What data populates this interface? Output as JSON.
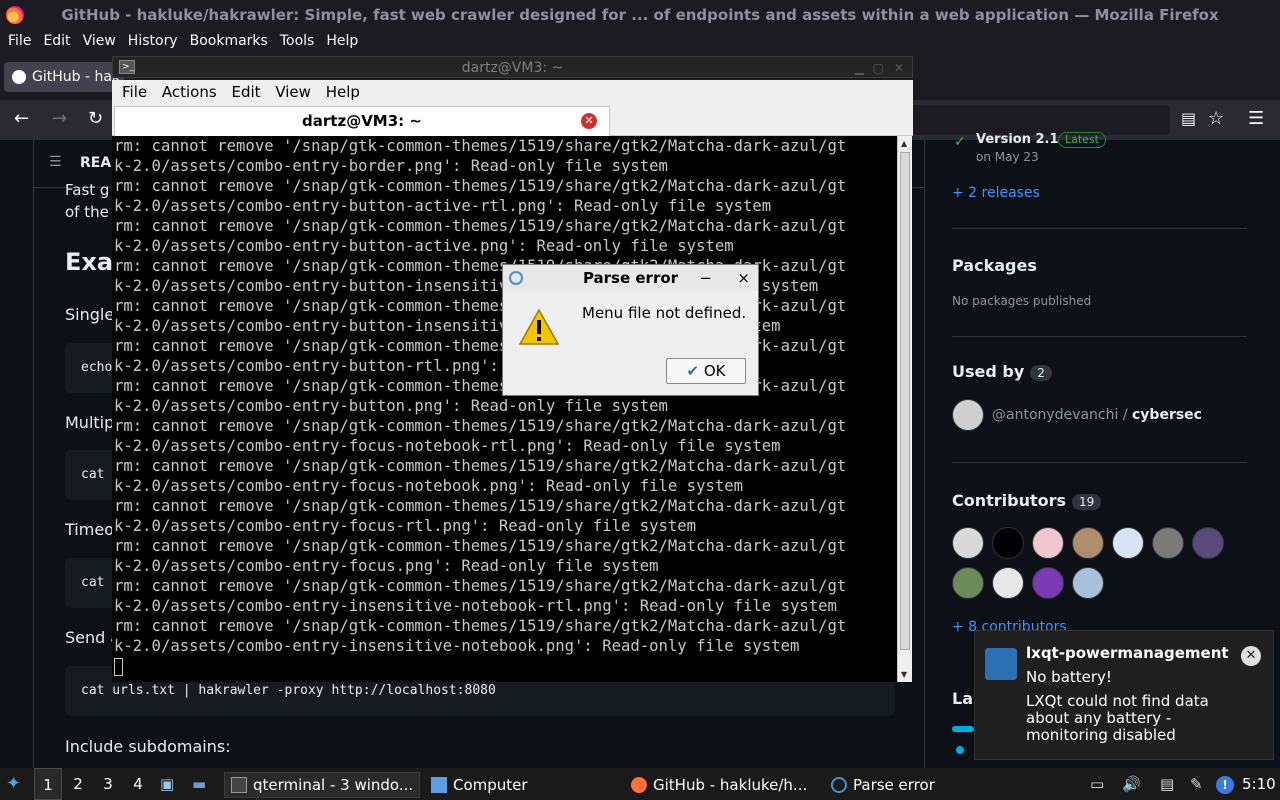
{
  "firefox": {
    "title": "GitHub - hakluke/hakrawler: Simple, fast web crawler designed for ...  of endpoints and assets within a web application — Mozilla Firefox",
    "menu": [
      "File",
      "Edit",
      "View",
      "History",
      "Bookmarks",
      "Tools",
      "Help"
    ],
    "tab_label": "GitHub - hak",
    "icons": [
      "back-arrow-icon",
      "forward-arrow-icon",
      "reload-icon",
      "reader-view-icon",
      "star-icon",
      "hamburger-menu-icon"
    ]
  },
  "github": {
    "readme_label": "REA",
    "fast_fragment": "Fast g",
    "of_the_fragment": "of the",
    "examples_heading": "Exa",
    "single_fragment": "Single",
    "code1": "echo",
    "multiple_fragment": "Multipl",
    "code2": "cat",
    "timeout_fragment": "Timeo",
    "code3": "cat",
    "send_fragment": "Send a",
    "proxy_code": "cat urls.txt | hakrawler -proxy http://localhost:8080",
    "include_subdomains": "Include subdomains:",
    "release_version": "Version 2.1",
    "release_badge": "Latest",
    "release_date": "on May 23",
    "releases_link": "+ 2 releases",
    "packages_heading": "Packages",
    "packages_text": "No packages published",
    "used_by_heading": "Used by",
    "used_by_count": "2",
    "used_by_user": "@antonydevanchi",
    "used_by_sep": "/",
    "used_by_repo": "cybersec",
    "contributors_heading": "Contributors",
    "contributors_count": "19",
    "more_contributors": "+ 8 contributors",
    "languages_fragment": "Lar"
  },
  "terminal": {
    "window_title": "dartz@VM3: ~",
    "menu": [
      "File",
      "Actions",
      "Edit",
      "View",
      "Help"
    ],
    "tab_title": "dartz@VM3: ~",
    "lines": [
      "rm: cannot remove '/snap/gtk-common-themes/1519/share/gtk2/Matcha-dark-azul/gt",
      "k-2.0/assets/combo-entry-border.png': Read-only file system",
      "rm: cannot remove '/snap/gtk-common-themes/1519/share/gtk2/Matcha-dark-azul/gt",
      "k-2.0/assets/combo-entry-button-active-rtl.png': Read-only file system",
      "rm: cannot remove '/snap/gtk-common-themes/1519/share/gtk2/Matcha-dark-azul/gt",
      "k-2.0/assets/combo-entry-button-active.png': Read-only file system",
      "rm: cannot remove '/snap/gtk-common-themes/1519/share/gtk2/Matcha-dark-azul/gt",
      "k-2.0/assets/combo-entry-button-insensitive-rtl.png': Read-only file system",
      "rm: cannot remove '/snap/gtk-common-themes/1519/share/gtk2/Matcha-dark-azul/gt",
      "k-2.0/assets/combo-entry-button-insensitive.png': Read-only file system",
      "rm: cannot remove '/snap/gtk-common-themes/1519/share/gtk2/Matcha-dark-azul/gt",
      "k-2.0/assets/combo-entry-button-rtl.png': Read-only file system",
      "rm: cannot remove '/snap/gtk-common-themes/1519/share/gtk2/Matcha-dark-azul/gt",
      "k-2.0/assets/combo-entry-button.png': Read-only file system",
      "rm: cannot remove '/snap/gtk-common-themes/1519/share/gtk2/Matcha-dark-azul/gt",
      "k-2.0/assets/combo-entry-focus-notebook-rtl.png': Read-only file system",
      "rm: cannot remove '/snap/gtk-common-themes/1519/share/gtk2/Matcha-dark-azul/gt",
      "k-2.0/assets/combo-entry-focus-notebook.png': Read-only file system",
      "rm: cannot remove '/snap/gtk-common-themes/1519/share/gtk2/Matcha-dark-azul/gt",
      "k-2.0/assets/combo-entry-focus-rtl.png': Read-only file system",
      "rm: cannot remove '/snap/gtk-common-themes/1519/share/gtk2/Matcha-dark-azul/gt",
      "k-2.0/assets/combo-entry-focus.png': Read-only file system",
      "rm: cannot remove '/snap/gtk-common-themes/1519/share/gtk2/Matcha-dark-azul/gt",
      "k-2.0/assets/combo-entry-insensitive-notebook-rtl.png': Read-only file system",
      "rm: cannot remove '/snap/gtk-common-themes/1519/share/gtk2/Matcha-dark-azul/gt",
      "k-2.0/assets/combo-entry-insensitive-notebook.png': Read-only file system"
    ]
  },
  "dialog": {
    "title": "Parse error",
    "message": "Menu file not defined.",
    "ok_label": "OK",
    "minimize_glyph": "−",
    "close_glyph": "×"
  },
  "notification": {
    "title": "lxqt-powermanagement",
    "subtitle": "No battery!",
    "body": "LXQt could not find data about any battery - monitoring disabled"
  },
  "taskbar": {
    "desktops": [
      "1",
      "2",
      "3",
      "4"
    ],
    "qterminal_label": "qterminal - 3 windo...",
    "computer_label": "Computer",
    "firefox_label": "GitHub - hakluke/h...",
    "parse_error_label": "Parse error",
    "clock": "5:10"
  },
  "colors": {
    "accent_link": "#4493f8",
    "dialog_bg": "#efefef",
    "terminal_bg": "#000000"
  }
}
